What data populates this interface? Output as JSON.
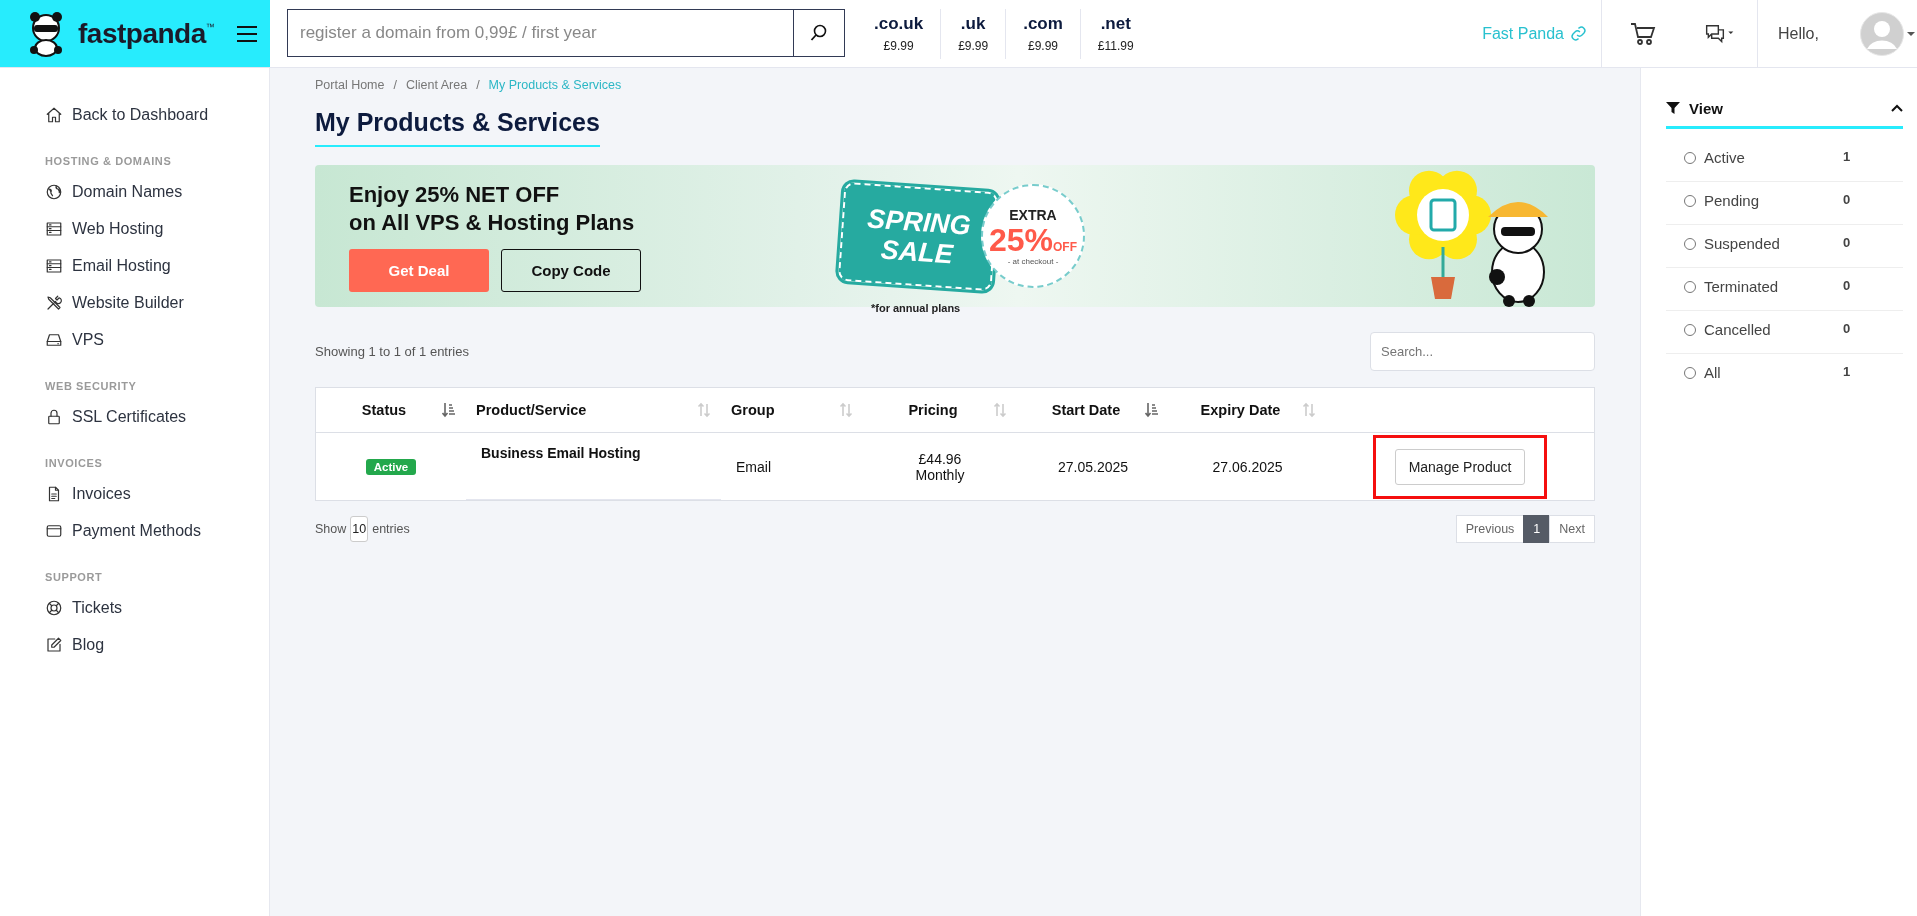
{
  "header": {
    "logo": "fastpanda",
    "logo_mark": "™",
    "search": {
      "placeholder": "register a domain from 0,99£ / first year"
    },
    "domains": [
      {
        "tld": ".co.uk",
        "price": "£9.99"
      },
      {
        "tld": ".uk",
        "price": "£9.99"
      },
      {
        "tld": ".com",
        "price": "£9.99"
      },
      {
        "tld": ".net",
        "price": "£11.99"
      }
    ],
    "site_link": "Fast Panda",
    "greeting": "Hello,"
  },
  "sidebar": {
    "back_link": "Back to Dashboard",
    "sections": [
      {
        "heading": "HOSTING & DOMAINS",
        "items": [
          "Domain Names",
          "Web Hosting",
          "Email Hosting",
          "Website Builder",
          "VPS"
        ]
      },
      {
        "heading": "WEB SECURITY",
        "items": [
          "SSL Certificates"
        ]
      },
      {
        "heading": "INVOICES",
        "items": [
          "Invoices",
          "Payment Methods"
        ]
      },
      {
        "heading": "SUPPORT",
        "items": [
          "Tickets",
          "Blog"
        ]
      }
    ]
  },
  "breadcrumb": [
    {
      "label": "Portal Home",
      "selected": false
    },
    {
      "label": "Client Area",
      "selected": false
    },
    {
      "label": "My Products & Services",
      "selected": true
    }
  ],
  "breadcrumb_separator": "/",
  "page_title": "My Products & Services",
  "banner": {
    "headline": [
      "Enjoy 25% NET OFF",
      "on All VPS & Hosting Plans"
    ],
    "buttons": [
      "Get Deal",
      "Copy Code"
    ],
    "promo": {
      "tag": [
        "SPRING",
        "SALE"
      ],
      "extra": "EXTRA",
      "percent": "25%",
      "off": "OFF",
      "checkout": "- at checkout -",
      "footnote": "*for annual plans"
    }
  },
  "table_info": "Showing 1 to 1 of 1 entries",
  "table_search": {
    "placeholder": "Search..."
  },
  "table": {
    "columns": [
      {
        "label": "Status",
        "sorted": true
      },
      {
        "label": "Product/Service",
        "sorted": false
      },
      {
        "label": "Group",
        "sorted": false
      },
      {
        "label": "Pricing",
        "sorted": false
      },
      {
        "label": "Start Date",
        "sorted": true
      },
      {
        "label": "Expiry Date",
        "sorted": false
      }
    ],
    "rows": [
      {
        "status": "Active",
        "product": "Business Email Hosting",
        "group": "Email",
        "price": "£44.96",
        "cycle": "Monthly",
        "start": "27.05.2025",
        "expiry": "27.06.2025",
        "action": "Manage Product",
        "highlighted": true
      }
    ]
  },
  "page_size": {
    "before": "Show",
    "value": "10",
    "after": "entries"
  },
  "pagination": [
    {
      "label": "Previous",
      "selected": false
    },
    {
      "label": "1",
      "selected": true
    },
    {
      "label": "Next",
      "selected": false
    }
  ],
  "view_panel": {
    "title": "View",
    "expanded": true,
    "filters": [
      {
        "label": "Active",
        "count": "1",
        "selected": false
      },
      {
        "label": "Pending",
        "count": "0",
        "selected": false
      },
      {
        "label": "Suspended",
        "count": "0",
        "selected": false
      },
      {
        "label": "Terminated",
        "count": "0",
        "selected": false
      },
      {
        "label": "Cancelled",
        "count": "0",
        "selected": false
      },
      {
        "label": "All",
        "count": "1",
        "selected": false
      }
    ]
  }
}
